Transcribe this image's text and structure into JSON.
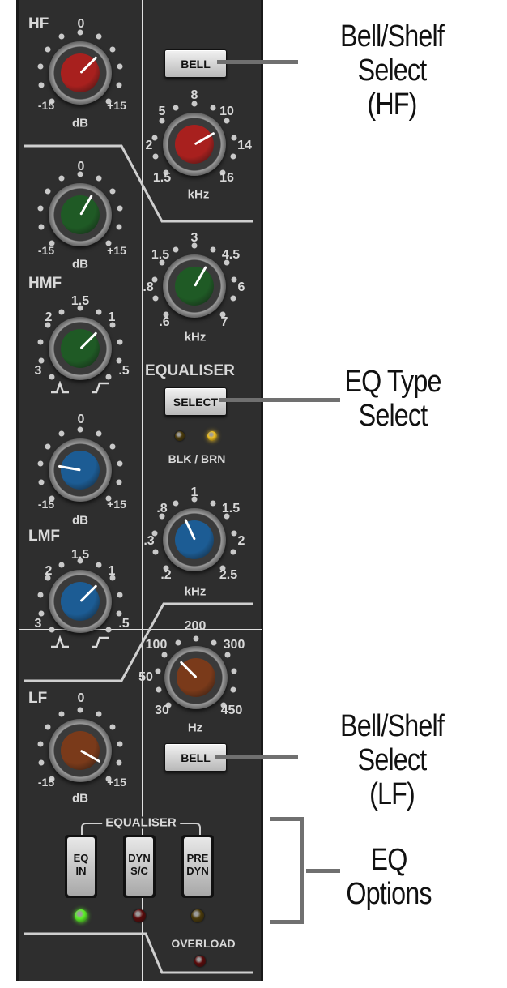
{
  "hf": {
    "title": "HF",
    "gain_scale": {
      "zero": "0",
      "min": "-15",
      "max": "+15",
      "unit": "dB"
    },
    "freq_scale": {
      "t1": "8",
      "t2": "5",
      "t3": "10",
      "t4": "2",
      "t5": "14",
      "t6": "1.5",
      "t7": "16",
      "unit": "kHz"
    },
    "bell_button": "BELL"
  },
  "hmf": {
    "title": "HMF",
    "gain_scale": {
      "zero": "0",
      "min": "-15",
      "max": "+15",
      "unit": "dB"
    },
    "freq_scale": {
      "t1": "3",
      "t2": "1.5",
      "t3": "4.5",
      "t4": ".8",
      "t5": "6",
      "t6": ".6",
      "t7": "7",
      "unit": "kHz"
    },
    "q_scale": {
      "t1": "1.5",
      "t2": "2",
      "t3": "1",
      "t4": "3",
      "t5": ".5"
    }
  },
  "equaliser": {
    "title": "EQUALISER",
    "select_button": "SELECT",
    "type_label": "BLK / BRN"
  },
  "lmf": {
    "title": "LMF",
    "gain_scale": {
      "zero": "0",
      "min": "-15",
      "max": "+15",
      "unit": "dB"
    },
    "freq_scale": {
      "t1": "1",
      "t2": ".8",
      "t3": "1.5",
      "t4": ".3",
      "t5": "2",
      "t6": ".2",
      "t7": "2.5",
      "unit": "kHz"
    },
    "q_scale": {
      "t1": "1.5",
      "t2": "2",
      "t3": "1",
      "t4": "3",
      "t5": ".5"
    }
  },
  "lf": {
    "title": "LF",
    "gain_scale": {
      "zero": "0",
      "min": "-15",
      "max": "+15",
      "unit": "dB"
    },
    "freq_scale": {
      "t1": "200",
      "t2": "100",
      "t3": "300",
      "t4": "50",
      "t6": "30",
      "t7": "450",
      "unit": "Hz"
    },
    "bell_button": "BELL"
  },
  "options": {
    "title": "EQUALISER",
    "eq_in": {
      "line1": "EQ",
      "line2": "IN"
    },
    "dyn_sc": {
      "line1": "DYN",
      "line2": "S/C"
    },
    "pre_dyn": {
      "line1": "PRE",
      "line2": "DYN"
    },
    "overload": "OVERLOAD"
  },
  "callouts": {
    "hf_shape": {
      "line1": "Bell/Shelf Select",
      "line2": "(HF)"
    },
    "eq_type": {
      "line1": "EQ Type",
      "line2": "Select"
    },
    "lf_shape": {
      "line1": "Bell/Shelf Select",
      "line2": "(LF)"
    },
    "eq_options": {
      "line1": "EQ",
      "line2": "Options"
    }
  },
  "colors": {
    "red_knob": "#a8201e",
    "green_knob": "#1f5a25",
    "blue_knob": "#1c5c94",
    "brown_knob": "#7a3a1a",
    "led_green_on": "#5cf028",
    "led_yellow_on": "#f0c020",
    "led_red_off": "#5a0a0a",
    "led_amber_off": "#4a3a0a"
  }
}
